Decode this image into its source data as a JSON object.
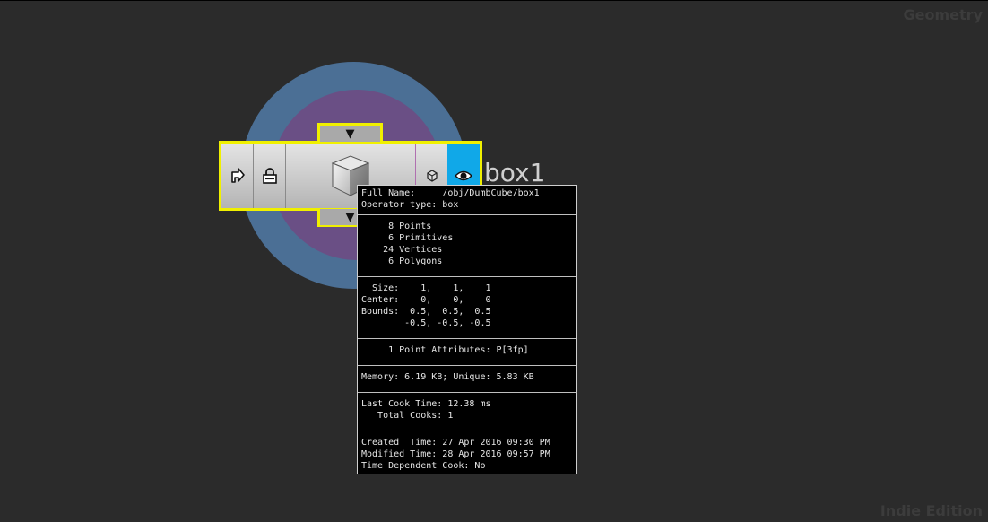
{
  "context_label": "Geometry",
  "edition_label": "Indie Edition",
  "node": {
    "name": "box1",
    "icons": {
      "bypass": "bypass-flag-icon",
      "lock": "lock-flag-icon",
      "main": "box-cube-icon",
      "template": "template-flag-icon",
      "display": "display-eye-icon",
      "input_arrow": "▼",
      "output_arrow": "▼"
    },
    "colors": {
      "selected_outline": "#f0f000",
      "display_flag": "#10a8e8",
      "ring_outer": "#4b6f95",
      "ring_inner": "#6a4f85"
    }
  },
  "info": {
    "header": [
      "Full Name:     /obj/DumbCube/box1",
      "Operator type: box"
    ],
    "counts": [
      "     8 Points",
      "     6 Primitives",
      "    24 Vertices",
      "     6 Polygons"
    ],
    "bounds": [
      "  Size:    1,    1,    1",
      "Center:    0,    0,    0",
      "Bounds:  0.5,  0.5,  0.5",
      "        -0.5, -0.5, -0.5"
    ],
    "attributes": [
      "     1 Point Attributes: P[3fp]"
    ],
    "memory": [
      "Memory: 6.19 KB; Unique: 5.83 KB"
    ],
    "cook": [
      "Last Cook Time: 12.38 ms",
      "   Total Cooks: 1"
    ],
    "times": [
      "Created  Time: 27 Apr 2016 09:30 PM",
      "Modified Time: 28 Apr 2016 09:57 PM",
      "Time Dependent Cook: No"
    ]
  }
}
